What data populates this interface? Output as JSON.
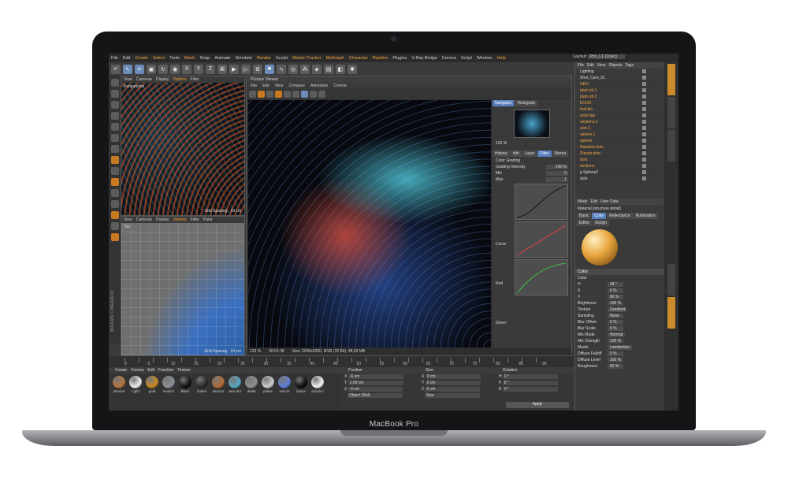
{
  "device": {
    "label": "MacBook Pro"
  },
  "menubar": {
    "items": [
      "File",
      "Edit",
      "Create",
      "Select",
      "Tools",
      "Mesh",
      "Snap",
      "Animate",
      "Simulate",
      "Render",
      "Sculpt",
      "Motion Tracker",
      "MoGraph",
      "Character",
      "Pipeline",
      "Plugins",
      "V-Ray Bridge",
      "Corona",
      "Script",
      "Window",
      "Help"
    ],
    "highlight": [
      "Create",
      "Select",
      "Mesh",
      "Render",
      "Motion Tracker",
      "MoGraph",
      "Character",
      "Pipeline",
      "Help"
    ],
    "layout_label": "Layout:",
    "layout_value": "Pro_L1 (User)"
  },
  "viewport_top": {
    "menu": [
      "View",
      "Cameras",
      "Display",
      "Options",
      "Filter"
    ],
    "active": "Options",
    "label": "Perspective",
    "footer": "Grid Spacing : 10 cm"
  },
  "viewport_bottom": {
    "menu": [
      "View",
      "Cameras",
      "Display",
      "Options",
      "Filter",
      "Pane"
    ],
    "active": "Options",
    "label": "Top",
    "footer": "Grid Spacing : 10 cm"
  },
  "vertical_brand": "MAXON CINEMA4D",
  "picture_viewer": {
    "title": "Picture Viewer",
    "menu": [
      "File",
      "Edit",
      "View",
      "Compare",
      "Animation",
      "Corona"
    ],
    "status": {
      "zoom": "133 %",
      "time": "00:01:38",
      "size": "Size: 2000x2000, RGB (32 Bit), 48,09 MB"
    }
  },
  "navigator": {
    "tabs": [
      "Navigator",
      "Histogram"
    ],
    "zoom": "133 %",
    "filter_tabs": [
      "History",
      "Info",
      "Layer",
      "Filter",
      "Stereo"
    ],
    "active_filter_tab": "Filter",
    "section": "Color Grading",
    "grading_intensity_label": "Grading Intensity",
    "grading_intensity": "100 %",
    "min_label": "Min",
    "min": "0",
    "max_label": "Max",
    "max": "1",
    "curves": [
      "Curve",
      "Red",
      "Green"
    ]
  },
  "object_manager": {
    "menu": [
      "File",
      "Edit",
      "View",
      "Objects",
      "Tags"
    ],
    "objects": [
      {
        "name": "Lighting",
        "selected": false
      },
      {
        "name": "Shot_Cam_01",
        "selected": false
      },
      {
        "name": "GEO",
        "selected": true
      },
      {
        "name": "plain.str.1",
        "selected": true
      },
      {
        "name": "plain.str.2",
        "selected": true
      },
      {
        "name": "ECHO",
        "selected": true
      },
      {
        "name": "trail.bin",
        "selected": true
      },
      {
        "name": "node.fgs",
        "selected": true
      },
      {
        "name": "sections.2",
        "selected": true
      },
      {
        "name": "wire.1",
        "selected": true
      },
      {
        "name": "sphere.1",
        "selected": true
      },
      {
        "name": "sphere",
        "selected": true
      },
      {
        "name": "Random.dots",
        "selected": true
      },
      {
        "name": "Planes.dots",
        "selected": true
      },
      {
        "name": "dots",
        "selected": true
      },
      {
        "name": "sections",
        "selected": true
      },
      {
        "name": "p.Sphere2",
        "selected": false
      },
      {
        "name": "dots",
        "selected": false
      }
    ]
  },
  "attributes": {
    "menu": [
      "Mode",
      "Edit",
      "User Data"
    ],
    "title": "Material [structure.detail]",
    "tabs": [
      "Basic",
      "Color",
      "Reflectance",
      "Illumination",
      "Editor",
      "Assign"
    ],
    "active_tab": "Color",
    "section": "Color",
    "props": [
      {
        "k": "Color",
        "v": ""
      },
      {
        "k": "H",
        "v": "34 °"
      },
      {
        "k": "S",
        "v": "0 %"
      },
      {
        "k": "V",
        "v": "80 %"
      },
      {
        "k": "Brightness",
        "v": "100 %"
      },
      {
        "k": "Texture",
        "v": "Gradient"
      },
      {
        "k": "Sampling",
        "v": "None"
      },
      {
        "k": "Blur Offset",
        "v": "0 %"
      },
      {
        "k": "Blur Scale",
        "v": "0 %"
      },
      {
        "k": "Mix Mode",
        "v": "Normal"
      },
      {
        "k": "Mix Strength",
        "v": "100 %"
      },
      {
        "k": "Model",
        "v": "Lambertian"
      },
      {
        "k": "Diffuse Falloff",
        "v": "0 %"
      },
      {
        "k": "Diffuse Level",
        "v": "100 %"
      },
      {
        "k": "Roughness",
        "v": "50 %"
      }
    ]
  },
  "timeline": {
    "ticks": [
      "0",
      "5",
      "10",
      "15",
      "20",
      "25",
      "30",
      "35",
      "40",
      "45",
      "50",
      "55",
      "60",
      "65",
      "70",
      "75",
      "80",
      "85",
      "90"
    ],
    "start_frame": "0 F",
    "end_frame": "90 F"
  },
  "materials": {
    "menu": [
      "Create",
      "Corona",
      "Edit",
      "Function",
      "Texture"
    ],
    "active": "Create",
    "items": [
      {
        "name": "structur",
        "color": "#b4763c"
      },
      {
        "name": "Light",
        "color": "#eeeeee"
      },
      {
        "name": "gold",
        "color": "#c98b23"
      },
      {
        "name": "metal.2",
        "color": "#8b8f98"
      },
      {
        "name": "Black",
        "color": "#111111"
      },
      {
        "name": "nodes",
        "color": "#2a2a2a"
      },
      {
        "name": "structur",
        "color": "#b36a34"
      },
      {
        "name": "wire.dot",
        "color": "#5aa6c2"
      },
      {
        "name": "detail",
        "color": "#909090"
      },
      {
        "name": "plates",
        "color": "#cccccc"
      },
      {
        "name": "wire.hi",
        "color": "#5c7fd6"
      },
      {
        "name": "space",
        "color": "#0d0d0d"
      },
      {
        "name": "simple.l",
        "color": "#f2f2f2"
      }
    ]
  },
  "coordinates": {
    "headers": [
      "Position",
      "Size",
      "Rotation"
    ],
    "rows": [
      {
        "axis": "X",
        "pos": "-6 cm",
        "size": "0 cm",
        "rot_axis": "H",
        "rot": "0 °"
      },
      {
        "axis": "Y",
        "pos": "1.09 cm",
        "size": "0 cm",
        "rot_axis": "P",
        "rot": "0 °"
      },
      {
        "axis": "Z",
        "pos": "-4 cm",
        "size": "0 cm",
        "rot_axis": "B",
        "rot": "0 °"
      }
    ],
    "mode_object": "Object (Rel)",
    "mode_size": "Size",
    "apply_label": "Apply"
  },
  "colors": {
    "accent": "#f7a53a",
    "selection": "#5a7fbf",
    "panel": "#3a3a3a"
  }
}
